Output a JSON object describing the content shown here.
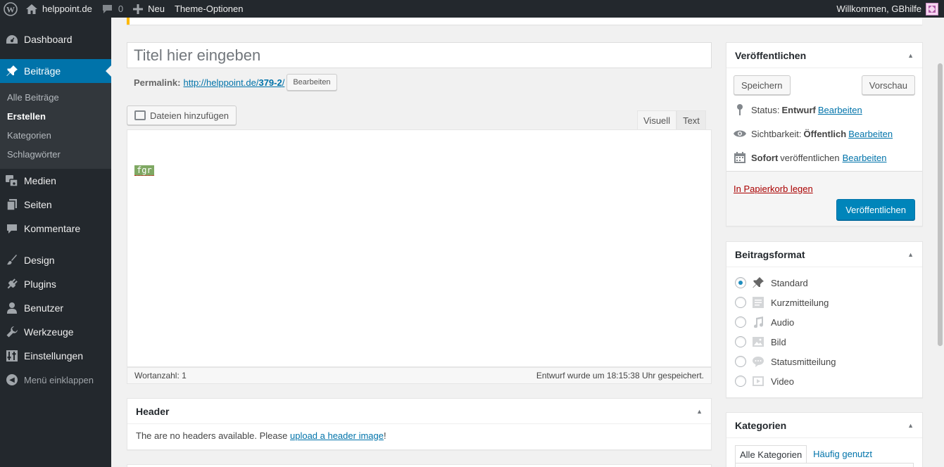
{
  "admin_bar": {
    "site_name": "helppoint.de",
    "comments_count": "0",
    "new_label": "Neu",
    "theme_options_label": "Theme-Optionen",
    "greeting": "Willkommen, GBhilfe"
  },
  "sidebar": {
    "dashboard": "Dashboard",
    "posts": "Beiträge",
    "posts_submenu": [
      "Alle Beiträge",
      "Erstellen",
      "Kategorien",
      "Schlagwörter"
    ],
    "media": "Medien",
    "pages": "Seiten",
    "comments": "Kommentare",
    "design": "Design",
    "plugins": "Plugins",
    "users": "Benutzer",
    "tools": "Werkzeuge",
    "settings": "Einstellungen",
    "collapse": "Menü einklappen"
  },
  "editor": {
    "title_placeholder": "Titel hier eingeben",
    "permalink_label": "Permalink:",
    "permalink_base": "http://helppoint.de/",
    "permalink_slug": "379-2",
    "permalink_trail": "/",
    "permalink_edit": "Bearbeiten",
    "add_media": "Dateien hinzufügen",
    "tab_visual": "Visuell",
    "tab_text": "Text",
    "content": "fgr",
    "word_count": "Wortanzahl: 1",
    "draft_saved": "Entwurf wurde um 18:15:38 Uhr gespeichert."
  },
  "header_box": {
    "title": "Header",
    "text_before": "The are no headers available. Please ",
    "link": "upload a header image",
    "text_after": "!"
  },
  "publish": {
    "title": "Veröffentlichen",
    "save": "Speichern",
    "preview": "Vorschau",
    "status_label": "Status:",
    "status_value": "Entwurf",
    "visibility_label": "Sichtbarkeit:",
    "visibility_value": "Öffentlich",
    "schedule_value": "Sofort",
    "schedule_label": "veröffentlichen",
    "edit": "Bearbeiten",
    "trash": "In Papierkorb legen",
    "publish_button": "Veröffentlichen"
  },
  "post_format": {
    "title": "Beitragsformat",
    "options": [
      "Standard",
      "Kurzmitteilung",
      "Audio",
      "Bild",
      "Statusmitteilung",
      "Video"
    ],
    "selected": "Standard"
  },
  "categories": {
    "title": "Kategorien",
    "tab_all": "Alle Kategorien",
    "tab_popular": "Häufig genutzt"
  },
  "colors": {
    "admin_bar_bg": "#23282d",
    "accent": "#0073aa",
    "publish_button": "#0085ba",
    "trash_link": "#a00000",
    "notice_border": "#ffb900"
  }
}
